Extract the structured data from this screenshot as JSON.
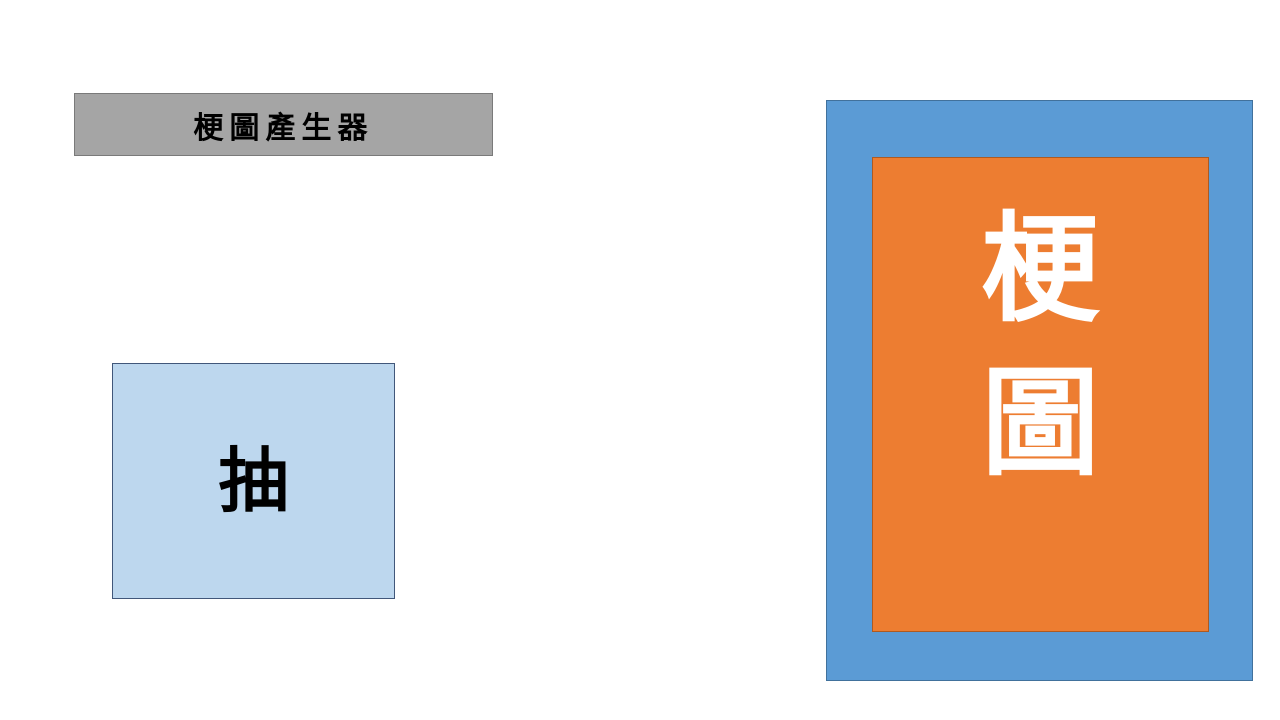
{
  "title": "梗圖產生器",
  "draw_button": {
    "label": "抽"
  },
  "card": {
    "line1": "梗",
    "line2": "圖"
  },
  "colors": {
    "title_bg": "#a5a5a5",
    "button_bg": "#bdd7ee",
    "card_frame": "#5b9bd5",
    "card_inner": "#ed7d31"
  }
}
